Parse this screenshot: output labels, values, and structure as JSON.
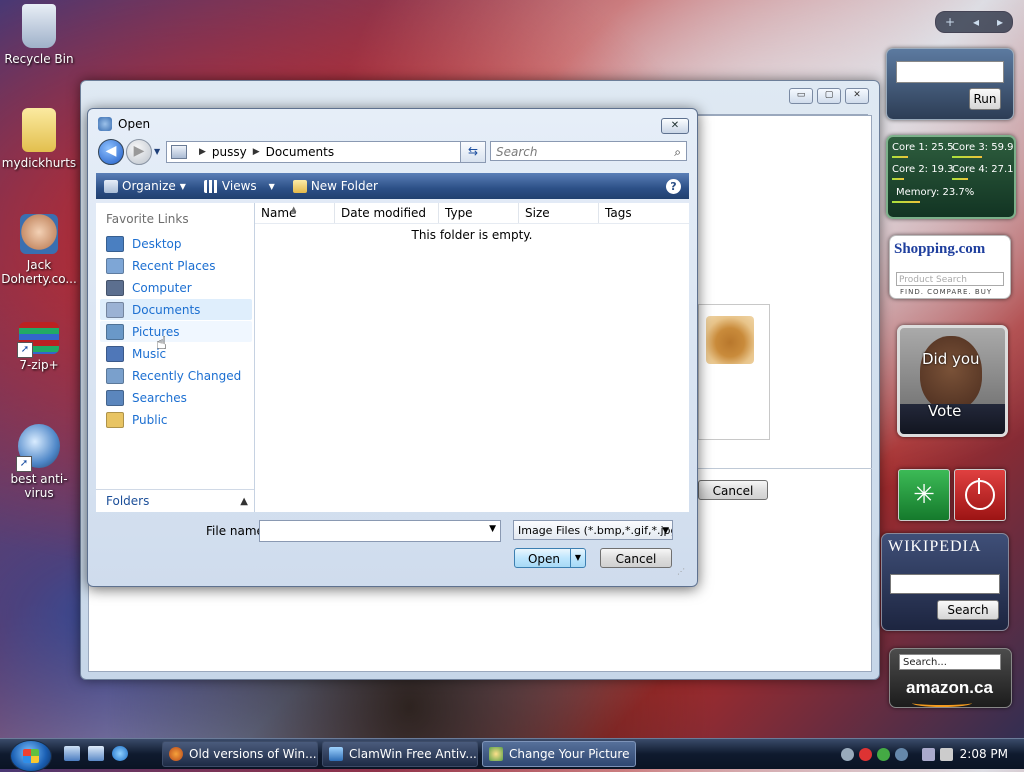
{
  "desktop": {
    "icons": [
      {
        "label": "Recycle Bin"
      },
      {
        "label": "mydickhurts"
      },
      {
        "label": "Jack Doherty.co..."
      },
      {
        "label": "7-zip+"
      },
      {
        "label": "best anti-virus"
      }
    ]
  },
  "background_window": {
    "cancel_label": "Cancel"
  },
  "dialog": {
    "title": "Open",
    "close_glyph": "✕",
    "address": {
      "segments": [
        "pussy",
        "Documents"
      ]
    },
    "search_placeholder": "Search",
    "toolbar": {
      "organize": "Organize",
      "views": "Views",
      "new_folder": "New Folder"
    },
    "favorite_links_header": "Favorite Links",
    "favorites": [
      {
        "label": "Desktop",
        "icon": "desktop-icon",
        "color": "#4a7fc1"
      },
      {
        "label": "Recent Places",
        "icon": "recent-places-icon",
        "color": "#7ea6d6"
      },
      {
        "label": "Computer",
        "icon": "computer-icon",
        "color": "#5c6f8f"
      },
      {
        "label": "Documents",
        "icon": "documents-icon",
        "color": "#9bb2d4"
      },
      {
        "label": "Pictures",
        "icon": "pictures-icon",
        "color": "#6a98c8"
      },
      {
        "label": "Music",
        "icon": "music-icon",
        "color": "#4f77b8"
      },
      {
        "label": "Recently Changed",
        "icon": "recently-changed-icon",
        "color": "#7aa0cc"
      },
      {
        "label": "Searches",
        "icon": "searches-icon",
        "color": "#5b86bd"
      },
      {
        "label": "Public",
        "icon": "public-folder-icon",
        "color": "#e8c463"
      }
    ],
    "folders_label": "Folders",
    "columns": [
      "Name",
      "Date modified",
      "Type",
      "Size",
      "Tags"
    ],
    "empty_message": "This folder is empty.",
    "file_name_label": "File name:",
    "file_name_value": "",
    "filter_value": "Image Files (*.bmp,*.gif,*.jpg,*",
    "open_label": "Open",
    "cancel_label": "Cancel"
  },
  "sidebar": {
    "run_label": "Run",
    "cpu": {
      "core1": "Core 1: 25.5",
      "core3": "Core 3: 59.9",
      "core2": "Core 2: 19.3",
      "core4": "Core 4: 27.1",
      "memory": "Memory: 23.7%"
    },
    "shopping": {
      "logo": "Shopping.com",
      "placeholder": "Product Search",
      "tagline": "FIND. COMPARE. BUY"
    },
    "photo": {
      "overlay_1": "Did you",
      "overlay_2": "Vote"
    },
    "wikipedia": {
      "title": "WIKIPEDIA",
      "search_label": "Search"
    },
    "amazon": {
      "search_placeholder": "Search...",
      "logo": "amazon.ca"
    }
  },
  "taskbar": {
    "buttons": [
      {
        "label": "Old versions of Win..."
      },
      {
        "label": "ClamWin Free Antiv..."
      },
      {
        "label": "Change Your Picture"
      }
    ],
    "clock": "2:08 PM"
  }
}
